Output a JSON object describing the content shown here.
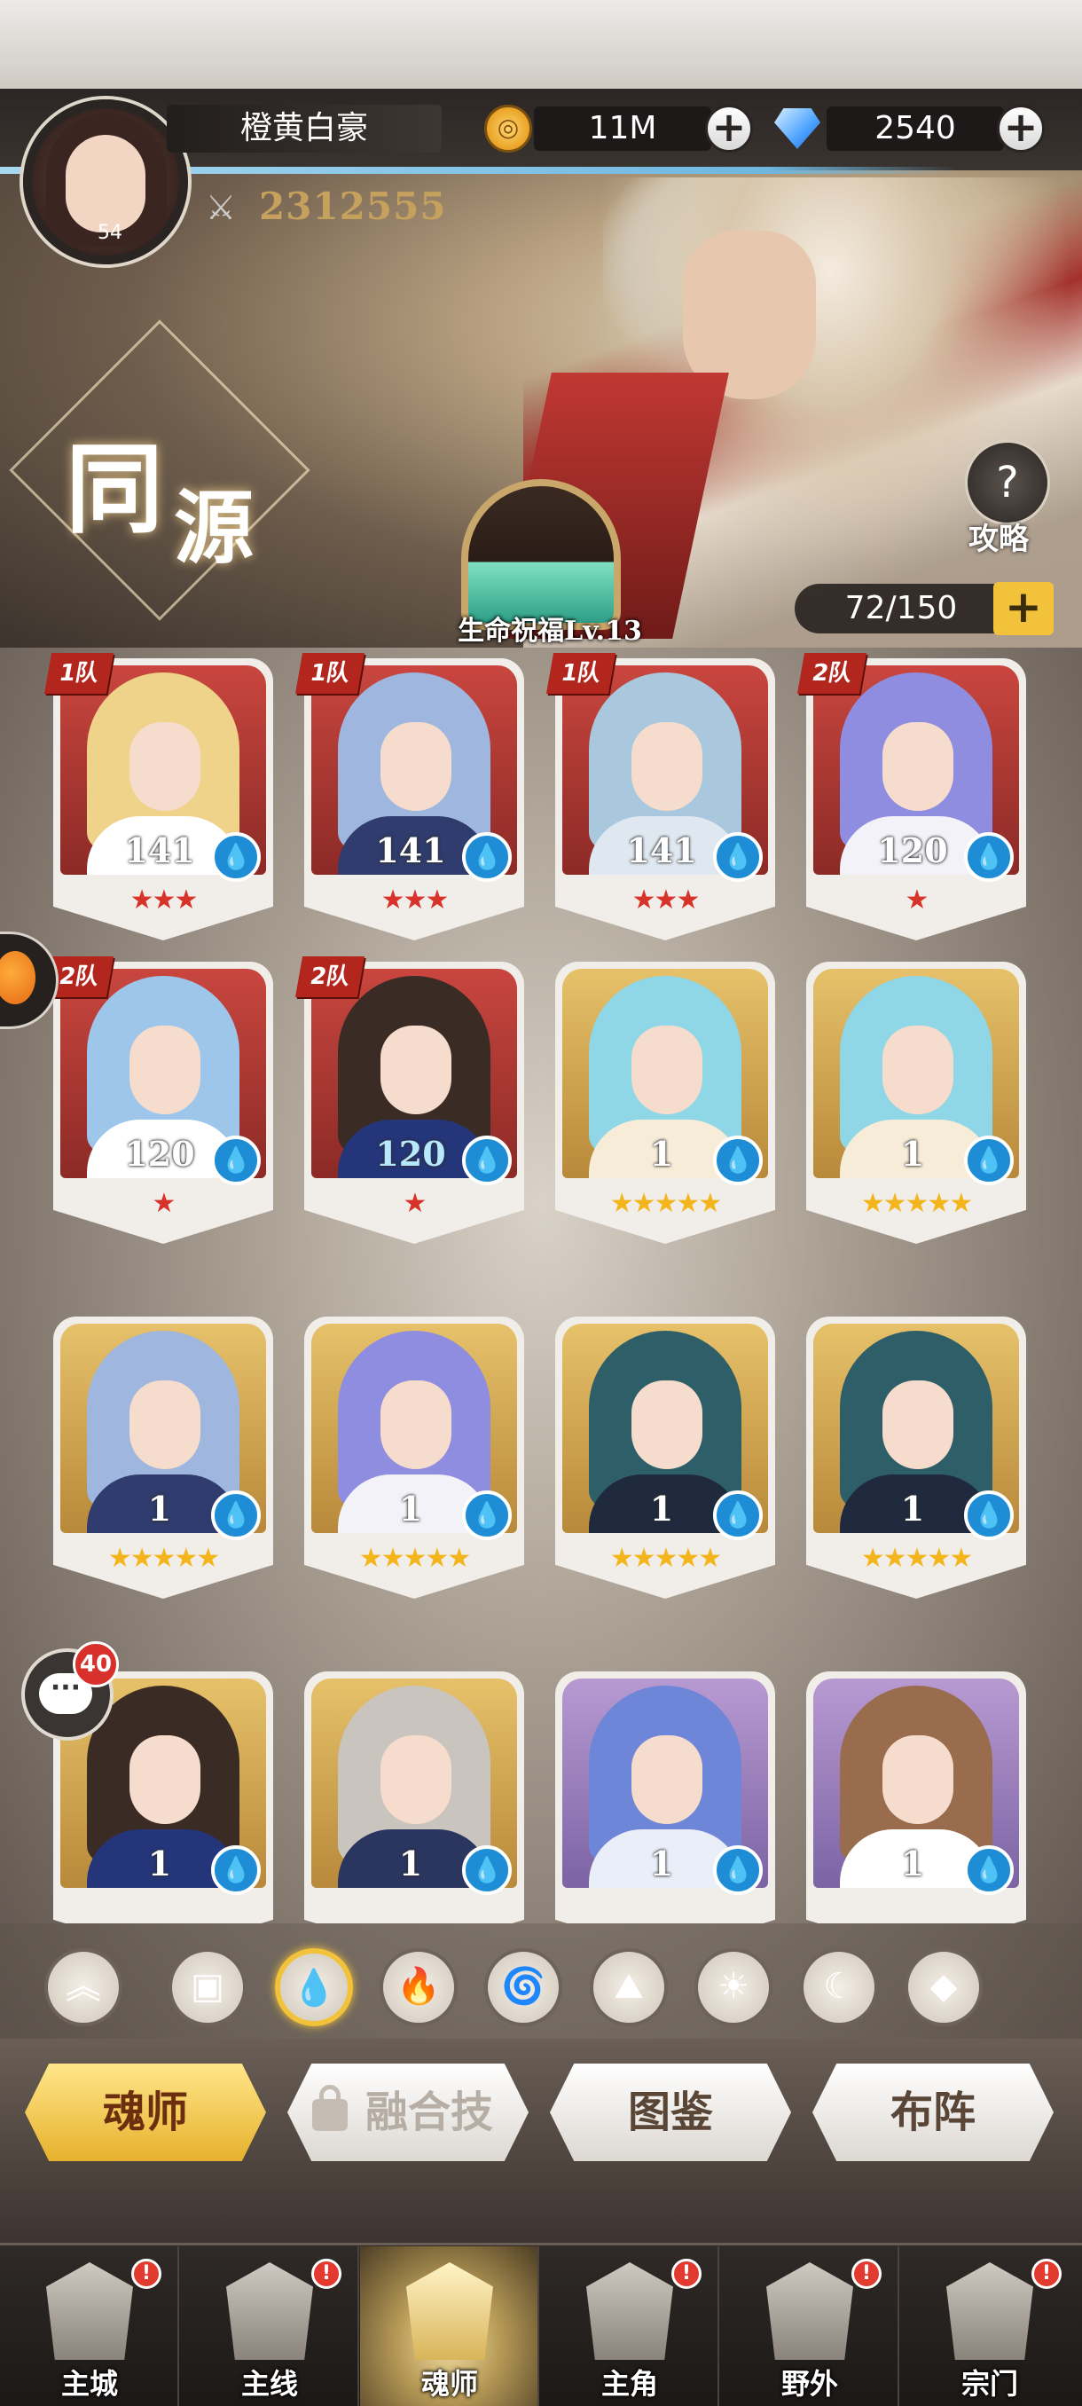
{
  "player": {
    "name": "橙黄白豪",
    "level": "54",
    "power": "2312555"
  },
  "resources": {
    "gold": "11M",
    "diamonds": "2540"
  },
  "banner": {
    "title_char_1": "同",
    "title_char_2": "源",
    "blessing": "生命祝福Lv.13",
    "guide_label": "攻略",
    "capacity": "72/150"
  },
  "cards": [
    {
      "team": "1队",
      "level": "141",
      "stars": "★★★",
      "star_color": "red",
      "frame": "red",
      "hair": "#f0d38a",
      "body": "#ffffff",
      "level_style": ""
    },
    {
      "team": "1队",
      "level": "141",
      "stars": "★★★",
      "star_color": "red",
      "frame": "red",
      "hair": "#9fb6df",
      "body": "#2f3c6d",
      "level_style": ""
    },
    {
      "team": "1队",
      "level": "141",
      "stars": "★★★",
      "star_color": "red",
      "frame": "red",
      "hair": "#a9c8de",
      "body": "#dfe8f0",
      "level_style": ""
    },
    {
      "team": "2队",
      "level": "120",
      "stars": "★",
      "star_color": "red",
      "frame": "red",
      "hair": "#8e8de0",
      "body": "#f2f2f8",
      "level_style": ""
    },
    {
      "team": "2队",
      "level": "120",
      "stars": "★",
      "star_color": "red",
      "frame": "red",
      "hair": "#9ec6ea",
      "body": "#ffffff",
      "level_style": ""
    },
    {
      "team": "2队",
      "level": "120",
      "stars": "★",
      "star_color": "red",
      "frame": "red",
      "hair": "#3a2c24",
      "body": "#24357a",
      "level_style": "blue"
    },
    {
      "team": "",
      "level": "1",
      "stars": "★★★★★",
      "star_color": "gold",
      "frame": "gold",
      "hair": "#8fd6e6",
      "body": "#f6ecd8",
      "level_style": ""
    },
    {
      "team": "",
      "level": "1",
      "stars": "★★★★★",
      "star_color": "gold",
      "frame": "gold",
      "hair": "#8fd6e6",
      "body": "#f6ecd8",
      "level_style": ""
    },
    {
      "team": "",
      "level": "1",
      "stars": "★★★★★",
      "star_color": "gold",
      "frame": "gold",
      "hair": "#9fb6df",
      "body": "#2f3c6d",
      "level_style": ""
    },
    {
      "team": "",
      "level": "1",
      "stars": "★★★★★",
      "star_color": "gold",
      "frame": "gold",
      "hair": "#8e8de0",
      "body": "#f2f2f8",
      "level_style": ""
    },
    {
      "team": "",
      "level": "1",
      "stars": "★★★★★",
      "star_color": "gold",
      "frame": "gold",
      "hair": "#2e5f68",
      "body": "#1f2a3e",
      "level_style": ""
    },
    {
      "team": "",
      "level": "1",
      "stars": "★★★★★",
      "star_color": "gold",
      "frame": "gold",
      "hair": "#2e5f68",
      "body": "#1f2a3e",
      "level_style": ""
    },
    {
      "team": "",
      "level": "1",
      "stars": "",
      "star_color": "gold",
      "frame": "gold",
      "hair": "#3a2c24",
      "body": "#24357a",
      "level_style": ""
    },
    {
      "team": "",
      "level": "1",
      "stars": "",
      "star_color": "gold",
      "frame": "gold",
      "hair": "#c9c4bd",
      "body": "#2a3560",
      "level_style": ""
    },
    {
      "team": "",
      "level": "1",
      "stars": "",
      "star_color": "gold",
      "frame": "purple",
      "hair": "#6d86d8",
      "body": "#e9eef8",
      "level_style": ""
    },
    {
      "team": "",
      "level": "1",
      "stars": "",
      "star_color": "gold",
      "frame": "purple",
      "hair": "#9a6c4e",
      "body": "#ffffff",
      "level_style": ""
    }
  ],
  "chat": {
    "badge": "40"
  },
  "filters": [
    {
      "name": "filter-sort-icon",
      "glyph": "︽",
      "active": false
    },
    {
      "name": "filter-box-icon",
      "glyph": "▣",
      "active": false
    },
    {
      "name": "filter-water-icon",
      "glyph": "💧",
      "active": true
    },
    {
      "name": "filter-fire-icon",
      "glyph": "🔥",
      "active": false
    },
    {
      "name": "filter-wind-icon",
      "glyph": "🌀",
      "active": false
    },
    {
      "name": "filter-earth-icon",
      "glyph": "⛰",
      "active": false
    },
    {
      "name": "filter-light-icon",
      "glyph": "☀",
      "active": false
    },
    {
      "name": "filter-dark-icon",
      "glyph": "☾",
      "active": false
    },
    {
      "name": "filter-special-icon",
      "glyph": "◆",
      "active": false
    }
  ],
  "tabs": [
    {
      "label": "魂师",
      "state": "active"
    },
    {
      "label": "融合技",
      "state": "locked"
    },
    {
      "label": "图鉴",
      "state": "normal"
    },
    {
      "label": "布阵",
      "state": "normal"
    }
  ],
  "nav": [
    {
      "label": "主城",
      "badge": "!",
      "active": false
    },
    {
      "label": "主线",
      "badge": "!",
      "active": false
    },
    {
      "label": "魂师",
      "badge": "",
      "active": true
    },
    {
      "label": "主角",
      "badge": "!",
      "active": false
    },
    {
      "label": "野外",
      "badge": "!",
      "active": false
    },
    {
      "label": "宗门",
      "badge": "!",
      "active": false
    }
  ],
  "colors": {
    "accent_gold": "#f2c33a",
    "team_tag_red": "#b3261e",
    "water_blue": "#1e8dd6"
  }
}
